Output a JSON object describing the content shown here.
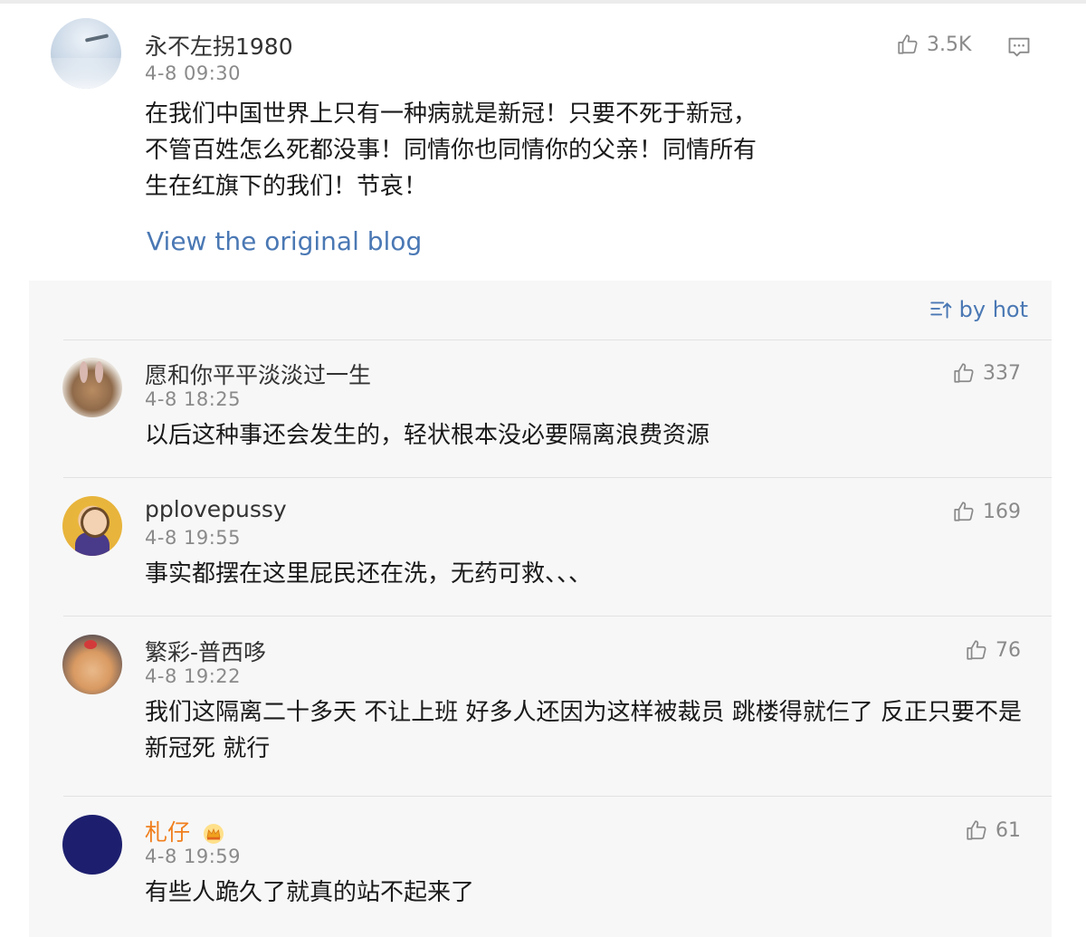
{
  "post": {
    "username": "永不左拐1980",
    "time": "4-8 09:30",
    "text": "在我们中国世界上只有一种病就是新冠！只要不死于新冠，不管百姓怎么死都没事！同情你也同情你的父亲！同情所有生在红旗下的我们！节哀！",
    "likes": "3.5K",
    "view_original_label": "View the original blog"
  },
  "comments_panel": {
    "sort_label": "by hot",
    "comments": [
      {
        "username": "愿和你平平淡淡过一生",
        "time": "4-8 18:25",
        "text": "以后这种事还会发生的，轻状根本没必要隔离浪费资源",
        "likes": "337"
      },
      {
        "username": "pplovepussy",
        "time": "4-8 19:55",
        "text": "事实都摆在这里屁民还在洗，无药可救、、、",
        "likes": "169"
      },
      {
        "username": "繁彩-普西哆",
        "time": "4-8 19:22",
        "text": "我们这隔离二十多天 不让上班 好多人还因为这样被裁员 跳楼得就仨了 反正只要不是新冠死 就行",
        "likes": "76"
      },
      {
        "username": "札仔",
        "time": "4-8 19:59",
        "text": "有些人跪久了就真的站不起来了",
        "likes": "61"
      }
    ]
  },
  "colors": {
    "link": "#4a78b4",
    "vip_name": "#f07f1e",
    "muted": "#8a8a8a",
    "panel_bg": "#f7f7f7"
  },
  "icons": [
    "thumbs-up-icon",
    "comment-icon",
    "sort-icon",
    "crown-badge-icon"
  ]
}
